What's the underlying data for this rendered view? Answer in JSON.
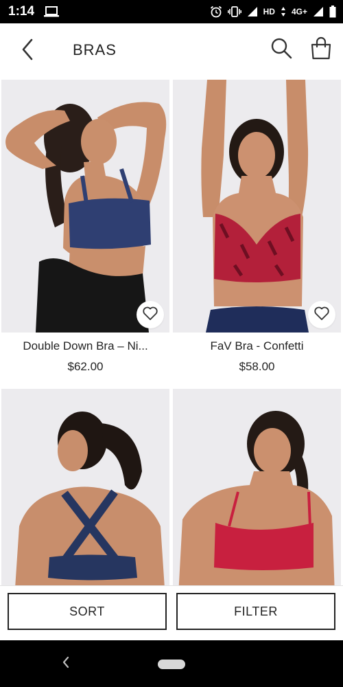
{
  "status_bar": {
    "time": "1:14",
    "network": "HD",
    "network_type": "4G+"
  },
  "header": {
    "title": "BRAS",
    "back_icon": "chevron-left-icon",
    "search_icon": "search-icon",
    "bag_icon": "shopping-bag-icon"
  },
  "products": [
    {
      "name": "Double Down Bra – Ni...",
      "price": "$62.00",
      "favorite_icon": "heart-outline-icon",
      "top_color": "#2f3f72"
    },
    {
      "name": "FaV Bra - Confetti",
      "price": "$58.00",
      "favorite_icon": "heart-outline-icon",
      "top_color": "#b3203a"
    },
    {
      "name": "",
      "price": "",
      "favorite_icon": "heart-outline-icon",
      "top_color": "#263660"
    },
    {
      "name": "",
      "price": "",
      "favorite_icon": "heart-outline-icon",
      "top_color": "#c8203f"
    }
  ],
  "actions": {
    "sort_label": "SORT",
    "filter_label": "FILTER"
  },
  "colors": {
    "image_background": "#ecebee",
    "text": "#222222"
  }
}
